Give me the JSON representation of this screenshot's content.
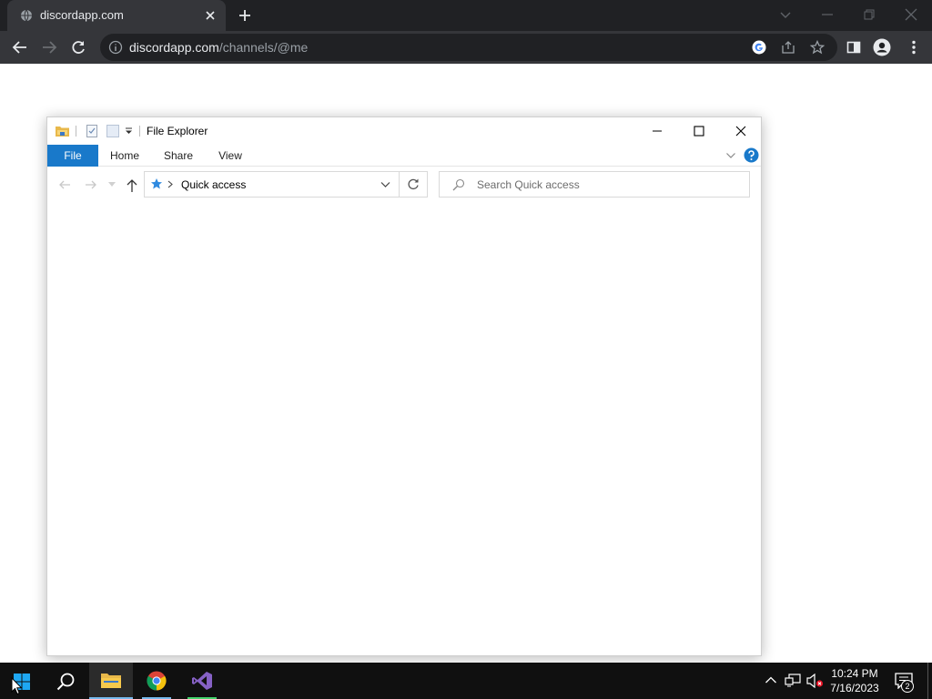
{
  "browser": {
    "tab_title": "discordapp.com",
    "url_domain": "discordapp.com",
    "url_path": "/channels/@me"
  },
  "explorer": {
    "title": "File Explorer",
    "ribbon_tabs": [
      "File",
      "Home",
      "Share",
      "View"
    ],
    "address": "Quick access",
    "search_placeholder": "Search Quick access"
  },
  "taskbar": {
    "time": "10:24 PM",
    "date": "7/16/2023",
    "notification_count": "2"
  },
  "colors": {
    "ribbon_file": "#1979ca",
    "taskbar": "#101010",
    "chrome_dark": "#202124",
    "chrome_tab": "#35363a"
  }
}
